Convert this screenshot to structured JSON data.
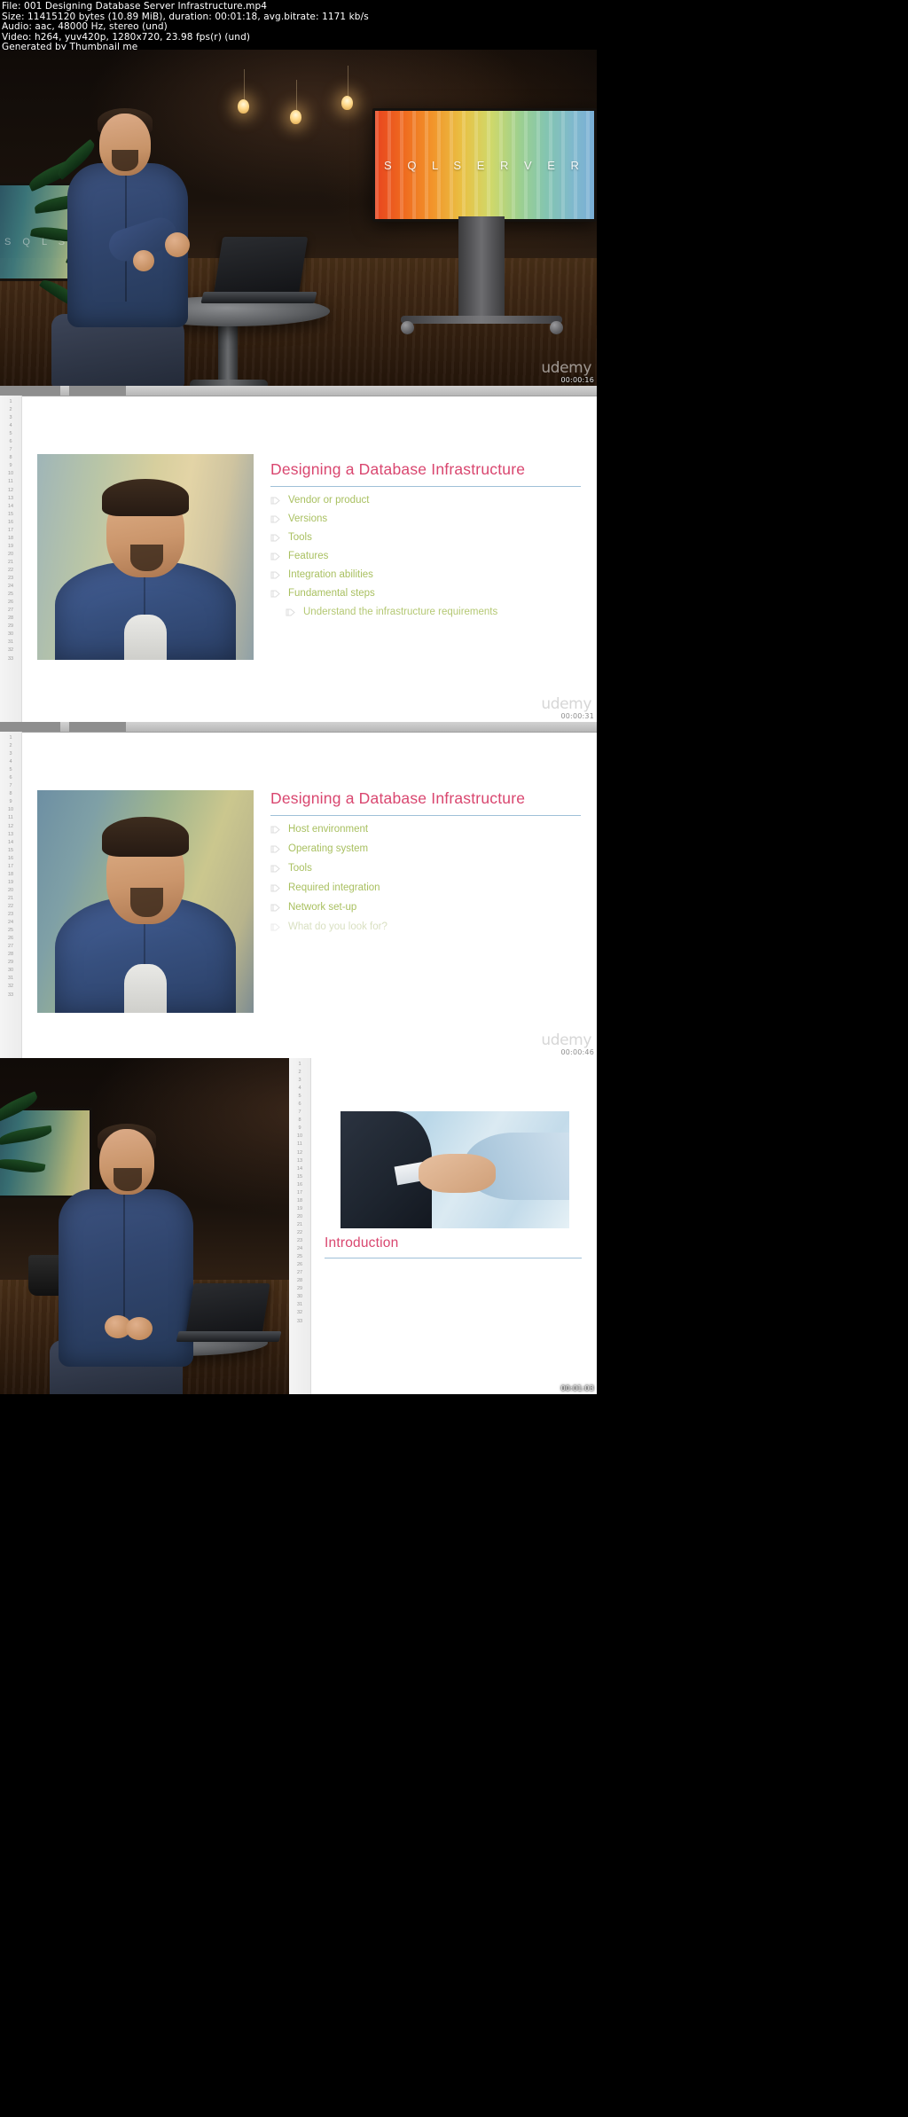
{
  "header": {
    "lines": [
      "File: 001 Designing Database Server Infrastructure.mp4",
      "Size: 11415120 bytes (10.89 MiB), duration: 00:01:18, avg.bitrate: 1171 kb/s",
      "Audio: aac, 48000 Hz, stereo (und)",
      "Video: h264, yuv420p, 1280x720, 23.98 fps(r) (und)",
      "Generated by Thumbnail me"
    ],
    "file_label": "File:",
    "file_name": "001 Designing Database Server Infrastructure.mp4",
    "size_bytes": "11415120 bytes",
    "size_human": "10.89 MiB",
    "duration": "00:01:18",
    "avg_bitrate": "1171 kb/s",
    "audio_codec": "aac",
    "audio_rate": "48000 Hz",
    "audio_channels": "stereo (und)",
    "video_codec": "h264",
    "pixel_format": "yuv420p",
    "resolution": "1280x720",
    "fps": "23.98 fps(r) (und)",
    "generator": "Generated by Thumbnail me"
  },
  "colors": {
    "title_pink": "#d9466f",
    "bullet_green": "#a9c061",
    "rule_blue": "#9fc0d8",
    "header_bg": "#000000",
    "header_fg": "#ffffff"
  },
  "watermark": "udemy",
  "thumbnails": [
    {
      "index": 1,
      "timestamp": "00:00:16",
      "kind": "video-frame",
      "scene": "presenter seated at table with laptop in front of SQL Server display",
      "screen_text": "S Q L   S E R V E R",
      "left_monitor_text": "S Q L   S E",
      "watermark": "udemy"
    },
    {
      "index": 2,
      "timestamp": "00:00:31",
      "kind": "slide",
      "title": "Designing a Database Infrastructure",
      "bullets": [
        {
          "text": "Vendor or product",
          "level": 1,
          "dim": false
        },
        {
          "text": "Versions",
          "level": 1,
          "dim": false
        },
        {
          "text": "Tools",
          "level": 1,
          "dim": false
        },
        {
          "text": "Features",
          "level": 1,
          "dim": false
        },
        {
          "text": "Integration abilities",
          "level": 1,
          "dim": false
        },
        {
          "text": "Fundamental steps",
          "level": 1,
          "dim": false
        },
        {
          "text": "Understand the infrastructure requirements",
          "level": 2,
          "dim": false
        }
      ],
      "watermark": "udemy"
    },
    {
      "index": 3,
      "timestamp": "00:00:46",
      "kind": "slide",
      "title": "Designing a Database Infrastructure",
      "bullets": [
        {
          "text": "Host environment",
          "level": 1,
          "dim": false
        },
        {
          "text": "Operating system",
          "level": 1,
          "dim": false
        },
        {
          "text": "Tools",
          "level": 1,
          "dim": false
        },
        {
          "text": "Required integration",
          "level": 1,
          "dim": false
        },
        {
          "text": "Network set-up",
          "level": 1,
          "dim": false
        },
        {
          "text": "What do you look for?",
          "level": 1,
          "dim": true
        }
      ],
      "watermark": "udemy"
    },
    {
      "index": 4,
      "timestamp": "00:01:03",
      "kind": "split",
      "left_kind": "video-frame",
      "right_kind": "slide",
      "title": "Introduction",
      "image_caption": "handshake photograph"
    }
  ],
  "gutter": {
    "numbers": [
      1,
      2,
      3,
      4,
      5,
      6,
      7,
      8,
      9,
      10,
      11,
      12,
      13,
      14,
      15,
      16,
      17,
      18,
      19,
      20,
      21,
      22,
      23,
      24,
      25,
      26,
      27,
      28,
      29,
      30,
      31,
      32,
      33
    ]
  }
}
